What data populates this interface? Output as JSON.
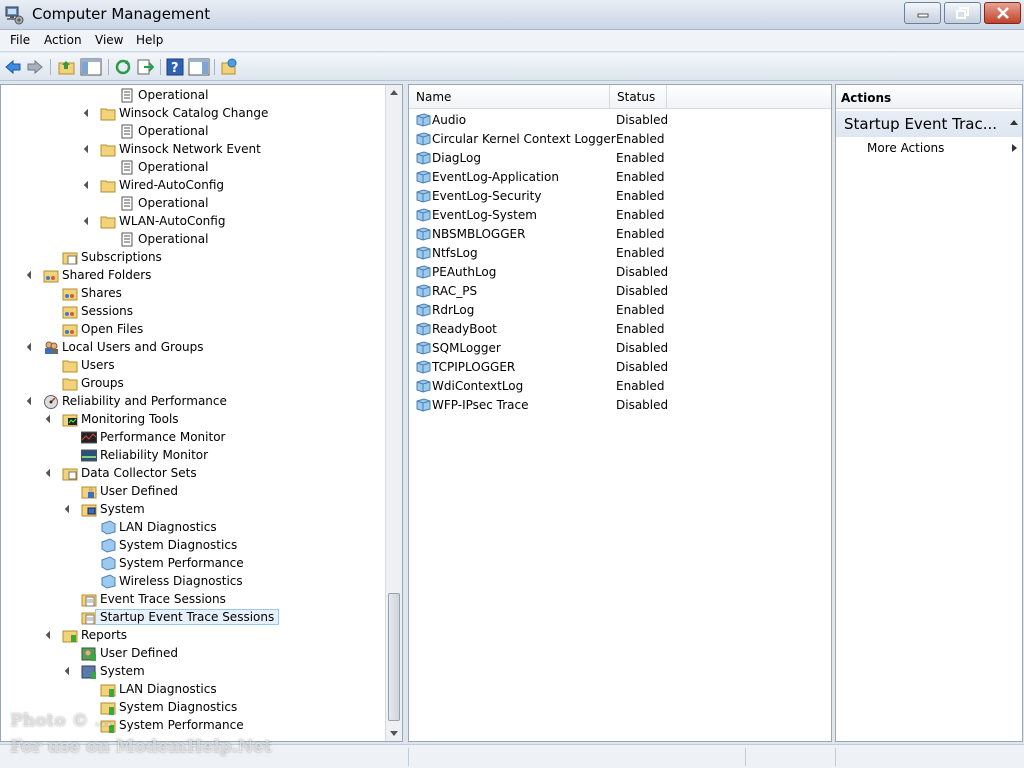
{
  "window": {
    "title": "Computer Management"
  },
  "menu": [
    "File",
    "Action",
    "View",
    "Help"
  ],
  "tree": [
    {
      "label": "Operational",
      "level": 4,
      "icon": "log-icon",
      "expander": false
    },
    {
      "label": "Winsock Catalog Change",
      "level": 3,
      "icon": "folder-icon",
      "expander": true
    },
    {
      "label": "Operational",
      "level": 4,
      "icon": "log-icon",
      "expander": false
    },
    {
      "label": "Winsock Network Event",
      "level": 3,
      "icon": "folder-icon",
      "expander": true
    },
    {
      "label": "Operational",
      "level": 4,
      "icon": "log-icon",
      "expander": false
    },
    {
      "label": "Wired-AutoConfig",
      "level": 3,
      "icon": "folder-icon",
      "expander": true
    },
    {
      "label": "Operational",
      "level": 4,
      "icon": "log-icon",
      "expander": false
    },
    {
      "label": "WLAN-AutoConfig",
      "level": 3,
      "icon": "folder-icon",
      "expander": true
    },
    {
      "label": "Operational",
      "level": 4,
      "icon": "log-icon",
      "expander": false
    },
    {
      "label": "Subscriptions",
      "level": 1,
      "icon": "subscriptions-icon",
      "expander": false
    },
    {
      "label": "Shared Folders",
      "level": 0,
      "icon": "shared-folder-icon",
      "expander": true
    },
    {
      "label": "Shares",
      "level": 1,
      "icon": "shared-folder-icon",
      "expander": false
    },
    {
      "label": "Sessions",
      "level": 1,
      "icon": "shared-folder-icon",
      "expander": false
    },
    {
      "label": "Open Files",
      "level": 1,
      "icon": "shared-folder-icon",
      "expander": false
    },
    {
      "label": "Local Users and Groups",
      "level": 0,
      "icon": "users-groups-icon",
      "expander": true
    },
    {
      "label": "Users",
      "level": 1,
      "icon": "folder-icon",
      "expander": false
    },
    {
      "label": "Groups",
      "level": 1,
      "icon": "folder-icon",
      "expander": false
    },
    {
      "label": "Reliability and Performance",
      "level": 0,
      "icon": "performance-icon",
      "expander": true
    },
    {
      "label": "Monitoring Tools",
      "level": 1,
      "icon": "monitor-folder-icon",
      "expander": true
    },
    {
      "label": "Performance Monitor",
      "level": 2,
      "icon": "performance-monitor-icon",
      "expander": false
    },
    {
      "label": "Reliability Monitor",
      "level": 2,
      "icon": "reliability-monitor-icon",
      "expander": false
    },
    {
      "label": "Data Collector Sets",
      "level": 1,
      "icon": "data-collector-icon",
      "expander": true
    },
    {
      "label": "User Defined",
      "level": 2,
      "icon": "user-defined-icon",
      "expander": false
    },
    {
      "label": "System",
      "level": 2,
      "icon": "system-folder-icon",
      "expander": true
    },
    {
      "label": "LAN Diagnostics",
      "level": 3,
      "icon": "collector-set-icon",
      "expander": false
    },
    {
      "label": "System Diagnostics",
      "level": 3,
      "icon": "collector-set-icon",
      "expander": false
    },
    {
      "label": "System Performance",
      "level": 3,
      "icon": "collector-set-icon",
      "expander": false
    },
    {
      "label": "Wireless Diagnostics",
      "level": 3,
      "icon": "collector-set-icon",
      "expander": false
    },
    {
      "label": "Event Trace Sessions",
      "level": 2,
      "icon": "trace-folder-icon",
      "expander": false
    },
    {
      "label": "Startup Event Trace Sessions",
      "level": 2,
      "icon": "trace-folder-icon",
      "expander": false,
      "selected": true
    },
    {
      "label": "Reports",
      "level": 1,
      "icon": "reports-icon",
      "expander": true
    },
    {
      "label": "User Defined",
      "level": 2,
      "icon": "report-user-icon",
      "expander": false
    },
    {
      "label": "System",
      "level": 2,
      "icon": "report-system-icon",
      "expander": true
    },
    {
      "label": "LAN Diagnostics",
      "level": 3,
      "icon": "report-folder-icon",
      "expander": false
    },
    {
      "label": "System Diagnostics",
      "level": 3,
      "icon": "report-folder-icon",
      "expander": false
    },
    {
      "label": "System Performance",
      "level": 3,
      "icon": "report-folder-icon",
      "expander": false
    }
  ],
  "list": {
    "columns": [
      "Name",
      "Status"
    ],
    "rows": [
      {
        "name": "Audio",
        "status": "Disabled"
      },
      {
        "name": "Circular Kernel Context Logger",
        "status": "Enabled"
      },
      {
        "name": "DiagLog",
        "status": "Enabled"
      },
      {
        "name": "EventLog-Application",
        "status": "Enabled"
      },
      {
        "name": "EventLog-Security",
        "status": "Enabled"
      },
      {
        "name": "EventLog-System",
        "status": "Enabled"
      },
      {
        "name": "NBSMBLOGGER",
        "status": "Enabled"
      },
      {
        "name": "NtfsLog",
        "status": "Enabled"
      },
      {
        "name": "PEAuthLog",
        "status": "Disabled"
      },
      {
        "name": "RAC_PS",
        "status": "Disabled"
      },
      {
        "name": "RdrLog",
        "status": "Enabled"
      },
      {
        "name": "ReadyBoot",
        "status": "Enabled"
      },
      {
        "name": "SQMLogger",
        "status": "Disabled"
      },
      {
        "name": "TCPIPLOGGER",
        "status": "Disabled"
      },
      {
        "name": "WdiContextLog",
        "status": "Enabled"
      },
      {
        "name": "WFP-IPsec Trace",
        "status": "Disabled"
      }
    ]
  },
  "actions": {
    "header": "Actions",
    "group_title": "Startup Event Trac...",
    "more": "More Actions"
  },
  "watermark": {
    "line1": "Photo © ...",
    "line2": "For use on ModemHelp.Net"
  },
  "colors": {
    "folder": "#f2d27a",
    "selection_bg": "#e6f1fb",
    "selection_border": "#9cc6ea"
  }
}
